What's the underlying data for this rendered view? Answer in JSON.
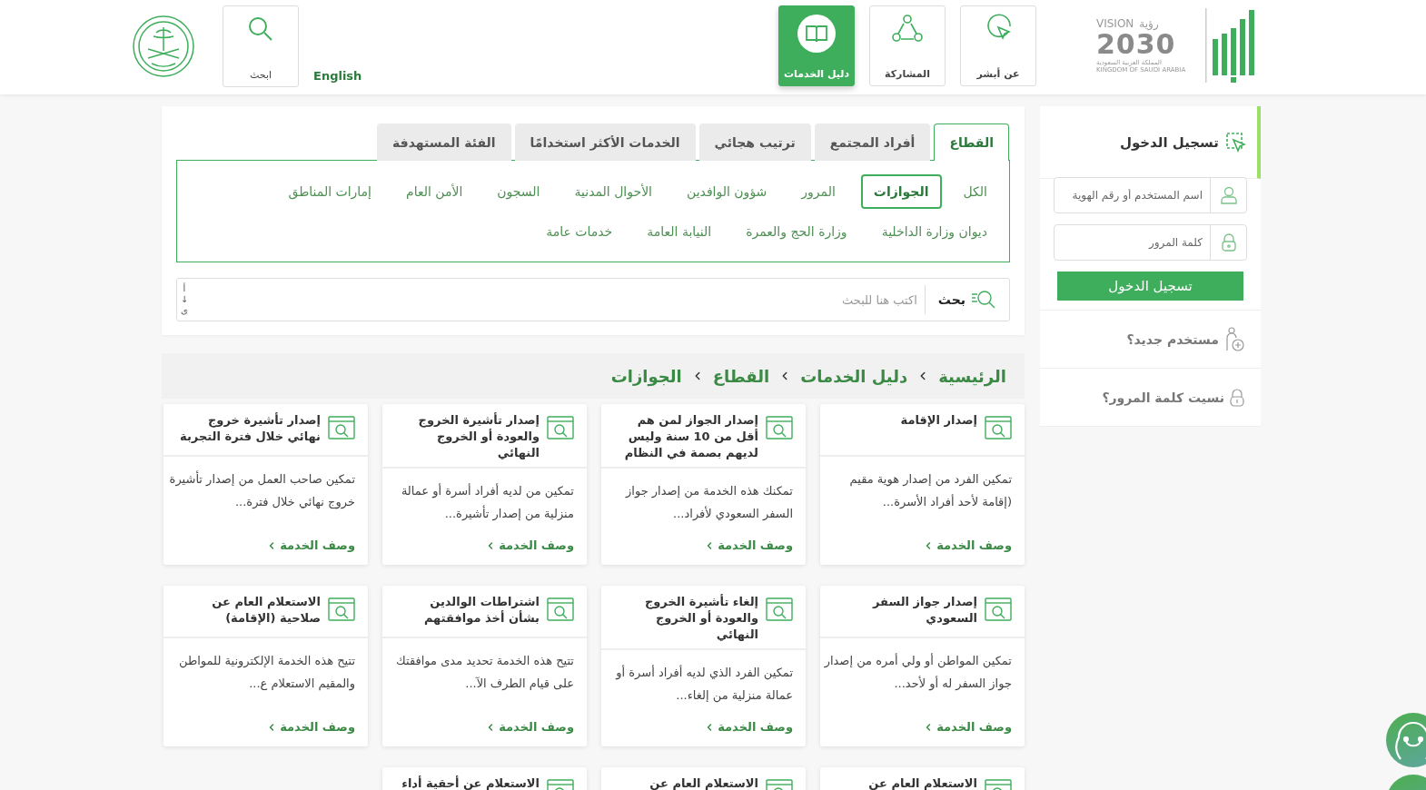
{
  "header": {
    "logo": {
      "vision": "VISION",
      "vision_ar": "رؤية",
      "year": "2030",
      "kingdom_ar": "المملكة العربية السعودية",
      "kingdom_en": "KINGDOM OF SAUDI ARABIA"
    },
    "nav": [
      {
        "label": "عن أبشر",
        "selected": false
      },
      {
        "label": "المشاركة",
        "selected": false
      },
      {
        "label": "دليل الخدمات",
        "selected": true
      }
    ],
    "language": "English",
    "search": "ابحث"
  },
  "login": {
    "title": "تسجيل الدخول",
    "username_placeholder": "اسم المستخدم أو رقم الهوية",
    "password_placeholder": "كلمة المرور",
    "button": "تسجيل الدخول",
    "links": [
      {
        "label": "مستخدم جديد؟"
      },
      {
        "label": "نسيت كلمة المرور؟"
      }
    ]
  },
  "filter": {
    "tabs": [
      {
        "label": "القطاع",
        "selected": true
      },
      {
        "label": "أفراد المجتمع",
        "selected": false
      },
      {
        "label": "ترتيب هجائي",
        "selected": false
      },
      {
        "label": "الخدمات الأكثر استخدامًا",
        "selected": false
      },
      {
        "label": "الفئة المستهدفة",
        "selected": false
      }
    ],
    "sector_rows": [
      [
        {
          "label": "الكل",
          "selected": false
        },
        {
          "label": "الجوازات",
          "selected": true
        },
        {
          "label": "المرور",
          "selected": false
        },
        {
          "label": "شؤون الوافدين",
          "selected": false
        },
        {
          "label": "الأحوال المدنية",
          "selected": false
        },
        {
          "label": "السجون",
          "selected": false
        },
        {
          "label": "الأمن العام",
          "selected": false
        },
        {
          "label": "إمارات المناطق",
          "selected": false
        }
      ],
      [
        {
          "label": "ديوان وزارة الداخلية",
          "selected": false
        },
        {
          "label": "وزارة الحج والعمرة",
          "selected": false
        },
        {
          "label": "النيابة العامة",
          "selected": false
        },
        {
          "label": "خدمات عامة",
          "selected": false
        }
      ]
    ],
    "search": {
      "button": "بحث",
      "placeholder": "اكتب هنا للبحث",
      "sort": [
        "أ",
        "↓",
        "ى"
      ]
    }
  },
  "breadcrumb": [
    "الرئيسية",
    "دليل الخدمات",
    "القطاع",
    "الجوازات"
  ],
  "services": [
    {
      "title": "إصدار الإقامة",
      "description": "تمكين الفرد من إصدار هوية مقيم (إقامة لأحد أفراد الأسرة...",
      "link": "وصف الخدمة"
    },
    {
      "title": "إصدار الجواز لمن هم أقل من 10 سنة وليس لديهم بصمة في النظام",
      "description": "تمكنك هذه الخدمة من إصدار جواز السفر السعودي لأفراد...",
      "link": "وصف الخدمة"
    },
    {
      "title": "إصدار تأشيرة الخروج والعودة أو الخروج النهائي",
      "description": "تمكين من لديه أفراد أسرة أو عمالة منزلية من إصدار تأشيرة...",
      "link": "وصف الخدمة"
    },
    {
      "title": "إصدار تأشيرة خروج نهائي خلال فترة التجربة",
      "description": "تمكين صاحب العمل من إصدار تأشيرة خروج نهائي خلال فترة...",
      "link": "وصف الخدمة"
    },
    {
      "title": "إصدار جواز السفر السعودي",
      "description": "تمكين المواطن أو ولي أمره من إصدار جواز السفر له أو لأحد...",
      "link": "وصف الخدمة"
    },
    {
      "title": "إلغاء تأشيرة الخروج والعودة أو الخروج النهائي",
      "description": "تمكين الفرد الذي لديه أفراد أسرة أو عمالة منزلية من إلغاء...",
      "link": "وصف الخدمة"
    },
    {
      "title": "اشتراطات الوالدين بشأن أخذ موافقتهم",
      "description": "تتيح هذه الخدمة تحديد مدى موافقتك على قيام الطرف الآ...",
      "link": "وصف الخدمة"
    },
    {
      "title": "الاستعلام العام عن صلاحية (الإقامة)",
      "description": "تتيح هذه الخدمة الإلكترونية للمواطن والمقيم الاستعلام ع...",
      "link": "وصف الخدمة"
    },
    {
      "title": "الاستعلام العام عن"
    },
    {
      "title": "الاستعلام العام عن"
    },
    {
      "title": "الاستعلام عن أحقية أداء"
    }
  ]
}
